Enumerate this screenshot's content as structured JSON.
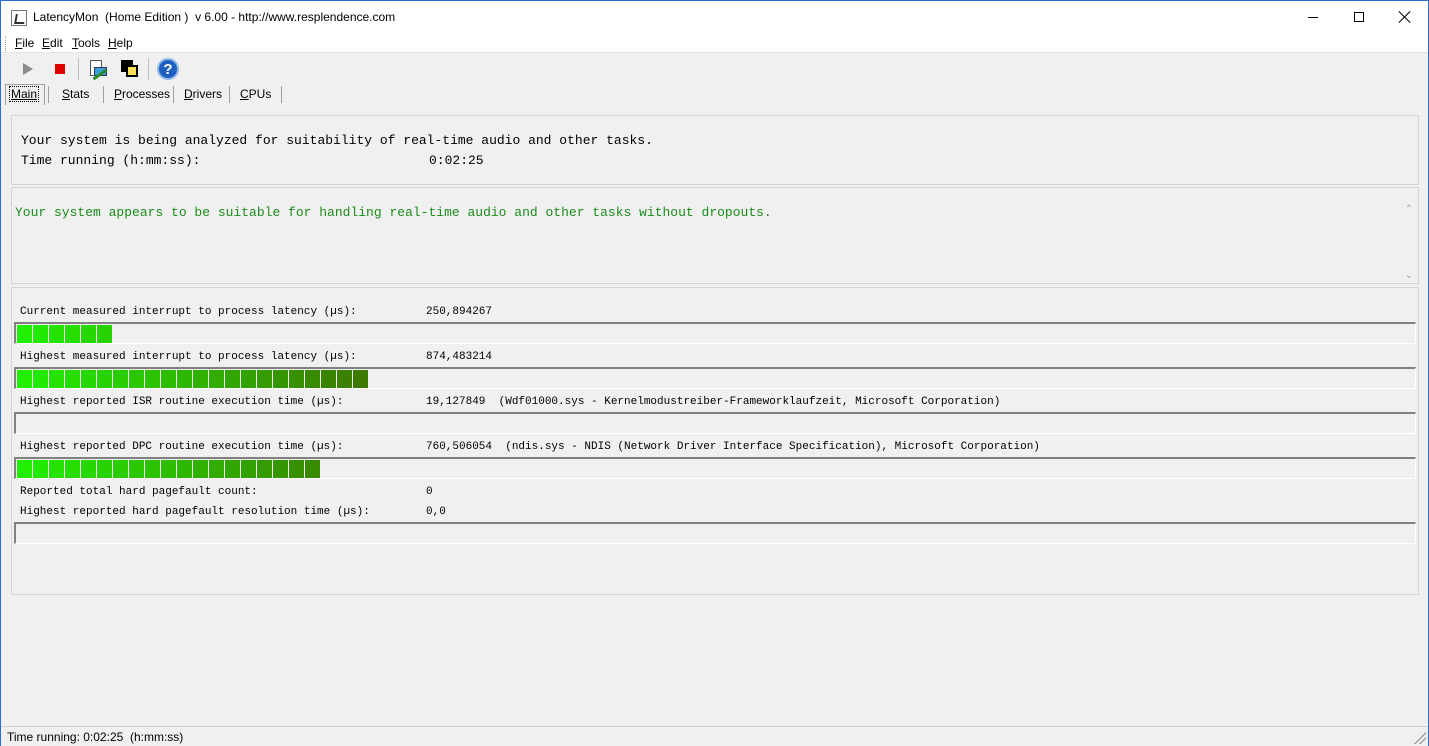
{
  "window": {
    "title": "LatencyMon  (Home Edition )  v 6.00 - http://www.resplendence.com",
    "icon": "latencymon-app-icon"
  },
  "menu": [
    {
      "label": "File",
      "underline": "F",
      "rest": "ile"
    },
    {
      "label": "Edit",
      "underline": "E",
      "rest": "dit"
    },
    {
      "label": "Tools",
      "underline": "T",
      "rest": "ools"
    },
    {
      "label": "Help",
      "underline": "H",
      "rest": "elp"
    }
  ],
  "toolbar": {
    "buttons": [
      "play-icon",
      "stop-icon",
      "report-icon",
      "cpu-icon",
      "help-icon"
    ]
  },
  "tabs": [
    {
      "label": "Main",
      "underline": "M",
      "rest": "ain",
      "active": true
    },
    {
      "label": "Stats",
      "underline": "S",
      "rest": "tats",
      "active": false
    },
    {
      "label": "Processes",
      "underline": "P",
      "rest": "rocesses",
      "active": false
    },
    {
      "label": "Drivers",
      "underline": "D",
      "rest": "rivers",
      "active": false
    },
    {
      "label": "CPUs",
      "underline": "C",
      "rest": "PUs",
      "active": false
    }
  ],
  "analysis": {
    "line1": "Your system is being analyzed for suitability of real-time audio and other tasks.",
    "line2_label": "Time running (h:mm:ss):",
    "line2_value": "0:02:25"
  },
  "verdict": {
    "message": "Your system appears to be suitable for handling real-time audio and other tasks without dropouts.",
    "color": "#1a8c1a"
  },
  "metrics": [
    {
      "label": "Current measured interrupt to process latency (µs):",
      "value": "250,894267",
      "has_bar": true,
      "segments": 6
    },
    {
      "label": "Highest measured interrupt to process latency (µs):",
      "value": "874,483214",
      "has_bar": true,
      "segments": 22
    },
    {
      "label": "Highest reported ISR routine execution time (µs):",
      "value": "19,127849  (Wdf01000.sys - Kernelmodustreiber-Frameworklaufzeit, Microsoft Corporation)",
      "has_bar": true,
      "segments": 0
    },
    {
      "label": "Highest reported DPC routine execution time (µs):",
      "value": "760,506054  (ndis.sys - NDIS (Network Driver Interface Specification), Microsoft Corporation)",
      "has_bar": true,
      "segments": 19
    },
    {
      "label": "Reported total hard pagefault count:",
      "value": "0",
      "has_bar": false,
      "segments": 0
    },
    {
      "label": "Highest reported hard pagefault resolution time (µs):",
      "value": "0,0",
      "has_bar": true,
      "segments": 0
    }
  ],
  "statusbar": {
    "text": "Time running: 0:02:25  (h:mm:ss)"
  },
  "colors": {
    "bar_green_bright": "#22ee00",
    "bar_green_dark": "#3c7a00",
    "title_border": "#2b6cd1"
  }
}
